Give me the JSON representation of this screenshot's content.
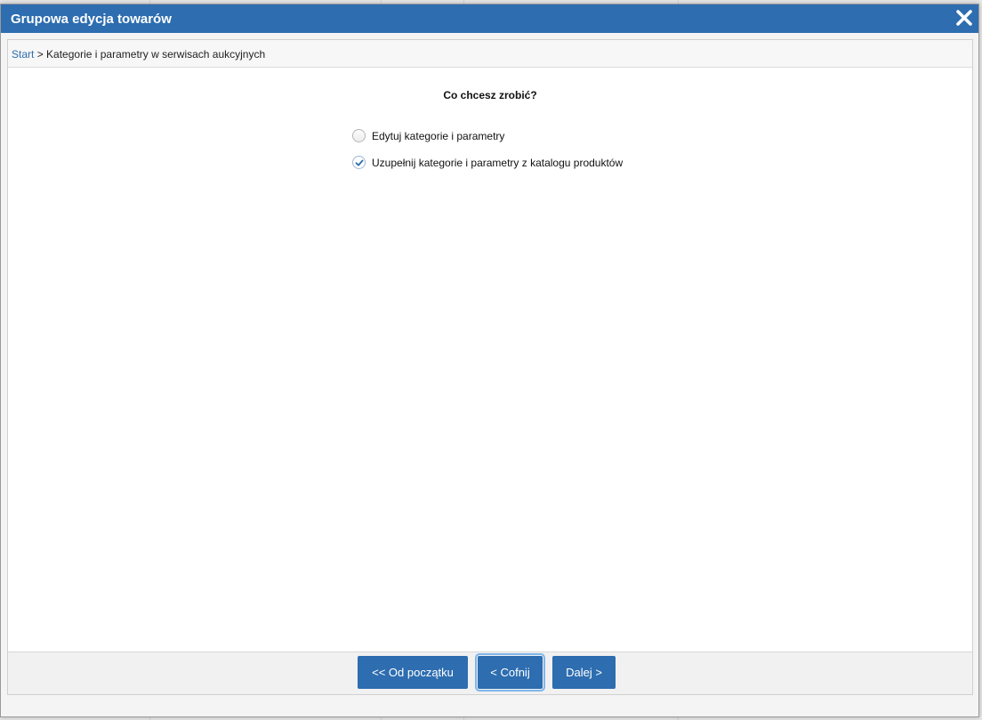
{
  "dialog": {
    "title": "Grupowa edycja towarów",
    "close_icon": "close-icon"
  },
  "breadcrumb": {
    "start_link": "Start",
    "separator": ">",
    "current": "Kategorie i parametry w serwisach aukcyjnych"
  },
  "question": "Co chcesz zrobić?",
  "options": [
    {
      "label": "Edytuj kategorie i parametry",
      "checked": false
    },
    {
      "label": "Uzupełnij kategorie i parametry z katalogu produktów",
      "checked": true
    }
  ],
  "buttons": {
    "first": "<< Od początku",
    "back": "< Cofnij",
    "next": "Dalej >"
  },
  "colors": {
    "accent": "#2d6db0",
    "check": "#2d6db0"
  }
}
